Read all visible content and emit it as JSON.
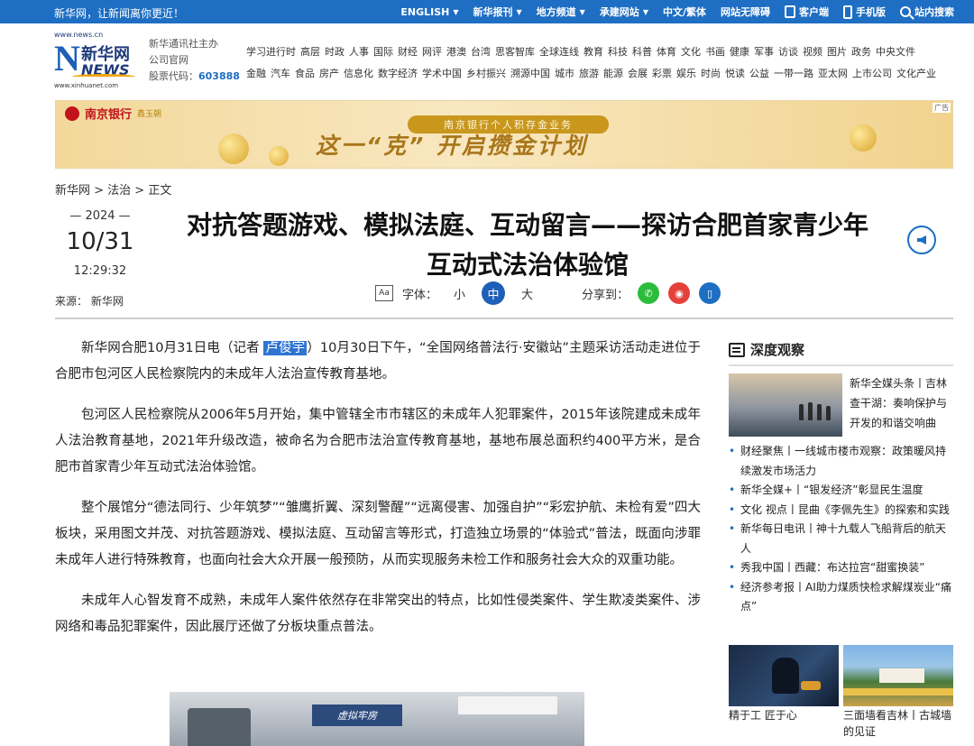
{
  "topbar": {
    "slogan": "新华网，让新闻离你更近！",
    "links": [
      "ENGLISH",
      "新华报刊",
      "地方频道",
      "承建网站",
      "中文/繁体",
      "网站无障碍",
      "客户端",
      "手机版",
      "站内搜索"
    ]
  },
  "logo": {
    "domain": "www.news.cn",
    "cn": "新华网",
    "en": "NEWS",
    "domain2": "www.xinhuanet.com"
  },
  "corp": {
    "line1": "新华通讯社主办",
    "line2": "公司官网",
    "stock_label": "股票代码：",
    "stock_code": "603888"
  },
  "nav": {
    "row1": [
      "学习进行时",
      "高层",
      "时政",
      "人事",
      "国际",
      "财经",
      "网评",
      "港澳",
      "台湾",
      "思客智库",
      "全球连线",
      "教育",
      "科技",
      "科普",
      "体育",
      "文化",
      "书画",
      "健康",
      "军事",
      "访谈",
      "视频",
      "图片",
      "政务",
      "中央文件"
    ],
    "row2": [
      "金融",
      "汽车",
      "食品",
      "房产",
      "信息化",
      "数字经济",
      "学术中国",
      "乡村振兴",
      "溯源中国",
      "城市",
      "旅游",
      "能源",
      "会展",
      "彩票",
      "娱乐",
      "时尚",
      "悦读",
      "公益",
      "一带一路",
      "亚太网",
      "上市公司",
      "文化产业"
    ]
  },
  "banner": {
    "bank": "南京银行",
    "bank_sub": "鑫玉朝",
    "sub": "南京银行个人积存金业务",
    "main": "这一“克” 开启攒金计划",
    "ad": "广告"
  },
  "breadcrumb": "新华网 > 法治 > 正文",
  "date": {
    "year": "2024",
    "monthday": "10/31",
    "time": "12:29:32"
  },
  "source": "来源：  新华网",
  "title_line1": "对抗答题游戏、模拟法庭、互动留言——探访合肥首家青少年",
  "title_line2": "互动式法治体验馆",
  "tools": {
    "font_label": "字体：",
    "small": "小",
    "medium": "中",
    "large": "大",
    "share_label": "分享到："
  },
  "article": {
    "p1_a": "新华网合肥10月31日电（记者 ",
    "p1_hl": "卢俊宇",
    "p1_b": "）10月30日下午，“全国网络普法行·安徽站”主题采访活动走进位于合肥市包河区人民检察院内的未成年人法治宣传教育基地。",
    "p2": "包河区人民检察院从2006年5月开始，集中管辖全市市辖区的未成年人犯罪案件，2015年该院建成未成年人法治教育基地，2021年升级改造，被命名为合肥市法治宣传教育基地，基地布展总面积约400平方米，是合肥市首家青少年互动式法治体验馆。",
    "p3": "整个展馆分“德法同行、少年筑梦”“雏鹰折翼、深刻警醒”“远离侵害、加强自护”“彩宏护航、未检有爱”四大板块，采用图文并茂、对抗答题游戏、模拟法庭、互动留言等形式，打造独立场景的“体验式”普法，既面向涉罪未成年人进行特殊教育，也面向社会大众开展一般预防，从而实现服务未检工作和服务社会大众的双重功能。",
    "p4": "未成年人心智发育不成熟，未成年人案件依然存在非常突出的特点，比如性侵类案件、学生欺凌类案件、涉网络和毒品犯罪案件，因此展厅还做了分板块重点普法。",
    "photo_sign": "虚拟牢房"
  },
  "sidebar": {
    "heading": "深度观察",
    "top_caption": "新华全媒头条丨吉林查干湖：奏响保护与开发的和谐交响曲",
    "items": [
      "财经聚焦丨一线城市楼市观察：政策暖风持续激发市场活力",
      "新华全媒+丨“银发经济”彰显民生温度",
      "文化 视点丨昆曲《李佩先生》的探索和实践",
      "新华每日电讯丨神十九载人飞船背后的航天人",
      "秀我中国丨西藏：布达拉宫“甜蜜换装”",
      "经济参考报丨AI助力煤质快检求解煤炭业“痛点”"
    ],
    "thumb1_caption": "精于工 匠于心",
    "thumb2_caption": "三面墙看吉林丨古城墙的见证"
  },
  "colors": {
    "brand": "#1e6ec3",
    "title": "#111111",
    "highlight": "#2f74d0"
  }
}
